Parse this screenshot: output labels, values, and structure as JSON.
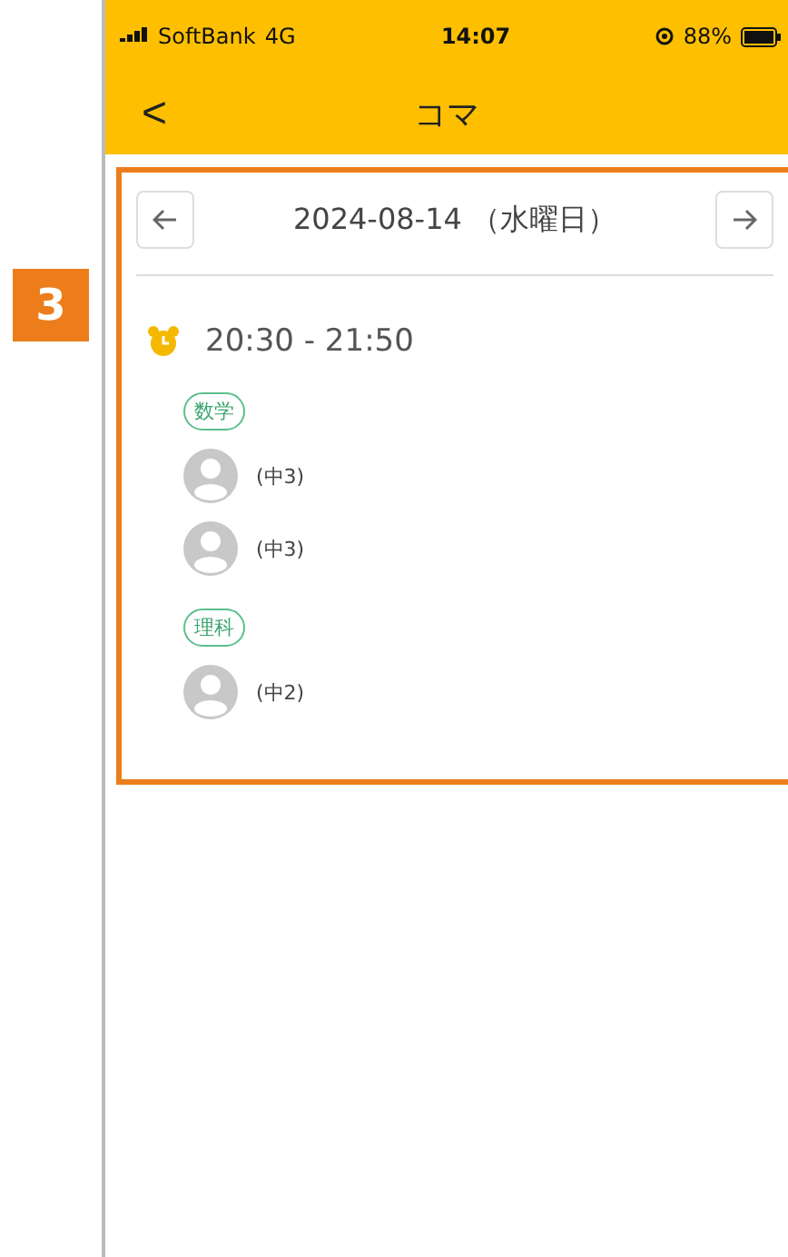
{
  "callout": "3",
  "status_bar": {
    "carrier": "SoftBank",
    "network": "4G",
    "time": "14:07",
    "battery": "88%"
  },
  "header": {
    "back": "<",
    "title": "コマ"
  },
  "date_nav": {
    "date": "2024-08-14 （水曜日）"
  },
  "slot": {
    "time": "20:30 - 21:50",
    "subjects": [
      {
        "name": "数学",
        "students": [
          {
            "grade": "(中3)"
          },
          {
            "grade": "(中3)"
          }
        ]
      },
      {
        "name": "理科",
        "students": [
          {
            "grade": "(中2)"
          }
        ]
      }
    ]
  }
}
